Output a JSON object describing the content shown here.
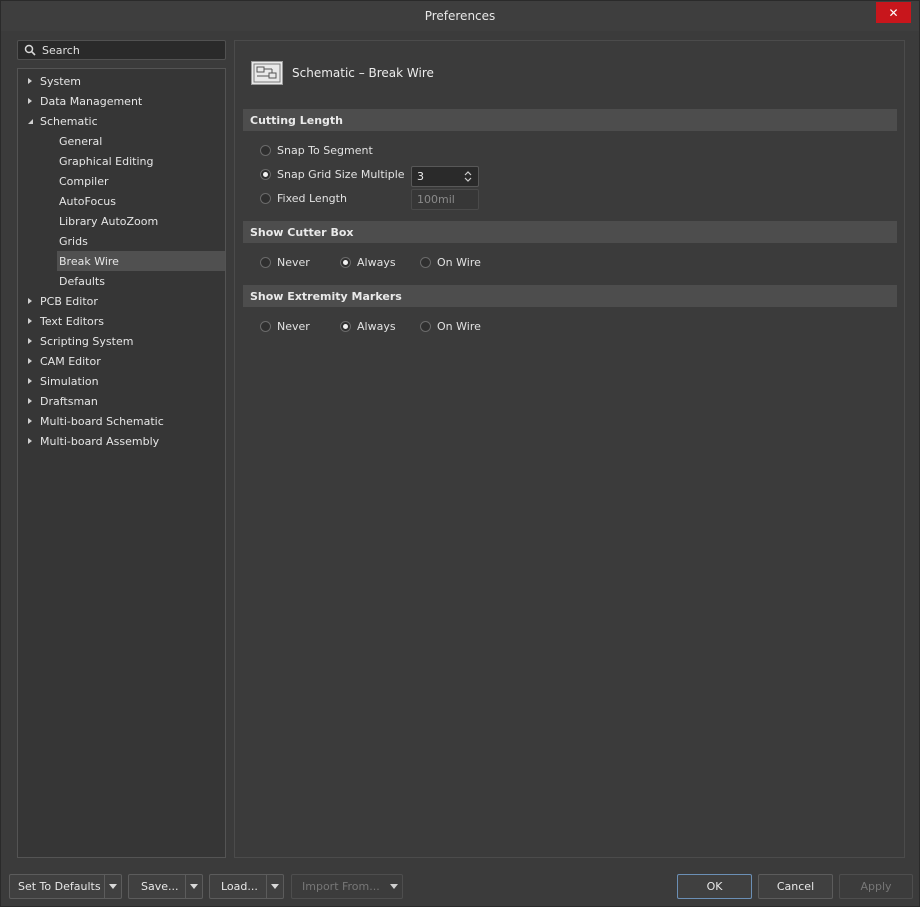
{
  "window": {
    "title": "Preferences",
    "close_glyph": "✕"
  },
  "search": {
    "placeholder": "Search"
  },
  "tree": {
    "items": [
      {
        "label": "System",
        "expanded": false
      },
      {
        "label": "Data Management",
        "expanded": false
      },
      {
        "label": "Schematic",
        "expanded": true
      }
    ],
    "schematic_children": [
      "General",
      "Graphical Editing",
      "Compiler",
      "AutoFocus",
      "Library AutoZoom",
      "Grids",
      "Break Wire",
      "Defaults"
    ],
    "after": [
      "PCB Editor",
      "Text Editors",
      "Scripting System",
      "CAM Editor",
      "Simulation",
      "Draftsman",
      "Multi-board Schematic",
      "Multi-board Assembly"
    ],
    "selected": "Break Wire"
  },
  "page": {
    "title": "Schematic – Break Wire",
    "icon": "schematic-sheet-icon"
  },
  "cutting_length": {
    "heading": "Cutting Length",
    "snap_to_segment": "Snap To Segment",
    "snap_grid_multiple": "Snap Grid Size Multiple",
    "snap_grid_value": "3",
    "fixed_length": "Fixed Length",
    "fixed_length_value": "100mil",
    "selected": "snap_grid_multiple"
  },
  "cutter_box": {
    "heading": "Show Cutter Box",
    "never": "Never",
    "always": "Always",
    "on_wire": "On Wire",
    "selected": "always"
  },
  "extremity": {
    "heading": "Show Extremity Markers",
    "never": "Never",
    "always": "Always",
    "on_wire": "On Wire",
    "selected": "always"
  },
  "footer": {
    "set_defaults": "Set To Defaults",
    "save": "Save...",
    "load": "Load...",
    "import_from": "Import From...",
    "ok": "OK",
    "cancel": "Cancel",
    "apply": "Apply"
  },
  "colors": {
    "close": "#c8161c",
    "selected_row": "#505050",
    "section_bar": "#4d4d4d"
  }
}
